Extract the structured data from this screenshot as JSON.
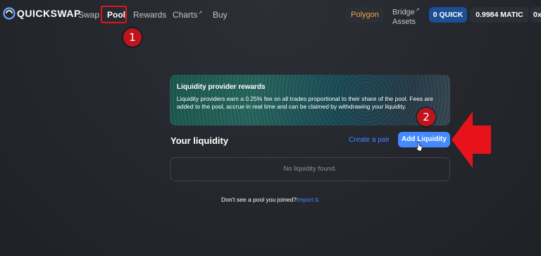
{
  "header": {
    "logo_text": "QUICKSWAP",
    "nav": {
      "swap": "Swap",
      "pool": "Pool",
      "rewards": "Rewards",
      "charts": "Charts",
      "buy": "Buy"
    },
    "network": "Polygon",
    "bridge_line1": "Bridge",
    "bridge_line2": "Assets",
    "quick_balance": "0 QUICK",
    "matic_balance": "0.9984 MATIC",
    "address_prefix": "0x"
  },
  "annotations": {
    "step1": "1",
    "step2": "2",
    "highlight_color": "#e0161c",
    "arrow_color": "#e8131a"
  },
  "rewards_card": {
    "title": "Liquidity provider rewards",
    "text": "Liquidity providers earn a 0.25% fee on all trades proportional to their share of the pool. Fees are added to the pool, accrue in real time and can be claimed by withdrawing your liquidity."
  },
  "liquidity": {
    "heading": "Your liquidity",
    "create_pair": "Create a pair",
    "add_liquidity": "Add Liquidity",
    "empty_message": "No liquidity found."
  },
  "footer": {
    "prompt": "Don't see a pool you joined?",
    "import_link": "Import it."
  },
  "colors": {
    "accent_blue": "#448aff",
    "network_orange": "#f6a44a",
    "quick_pill": "#1c4f95"
  }
}
